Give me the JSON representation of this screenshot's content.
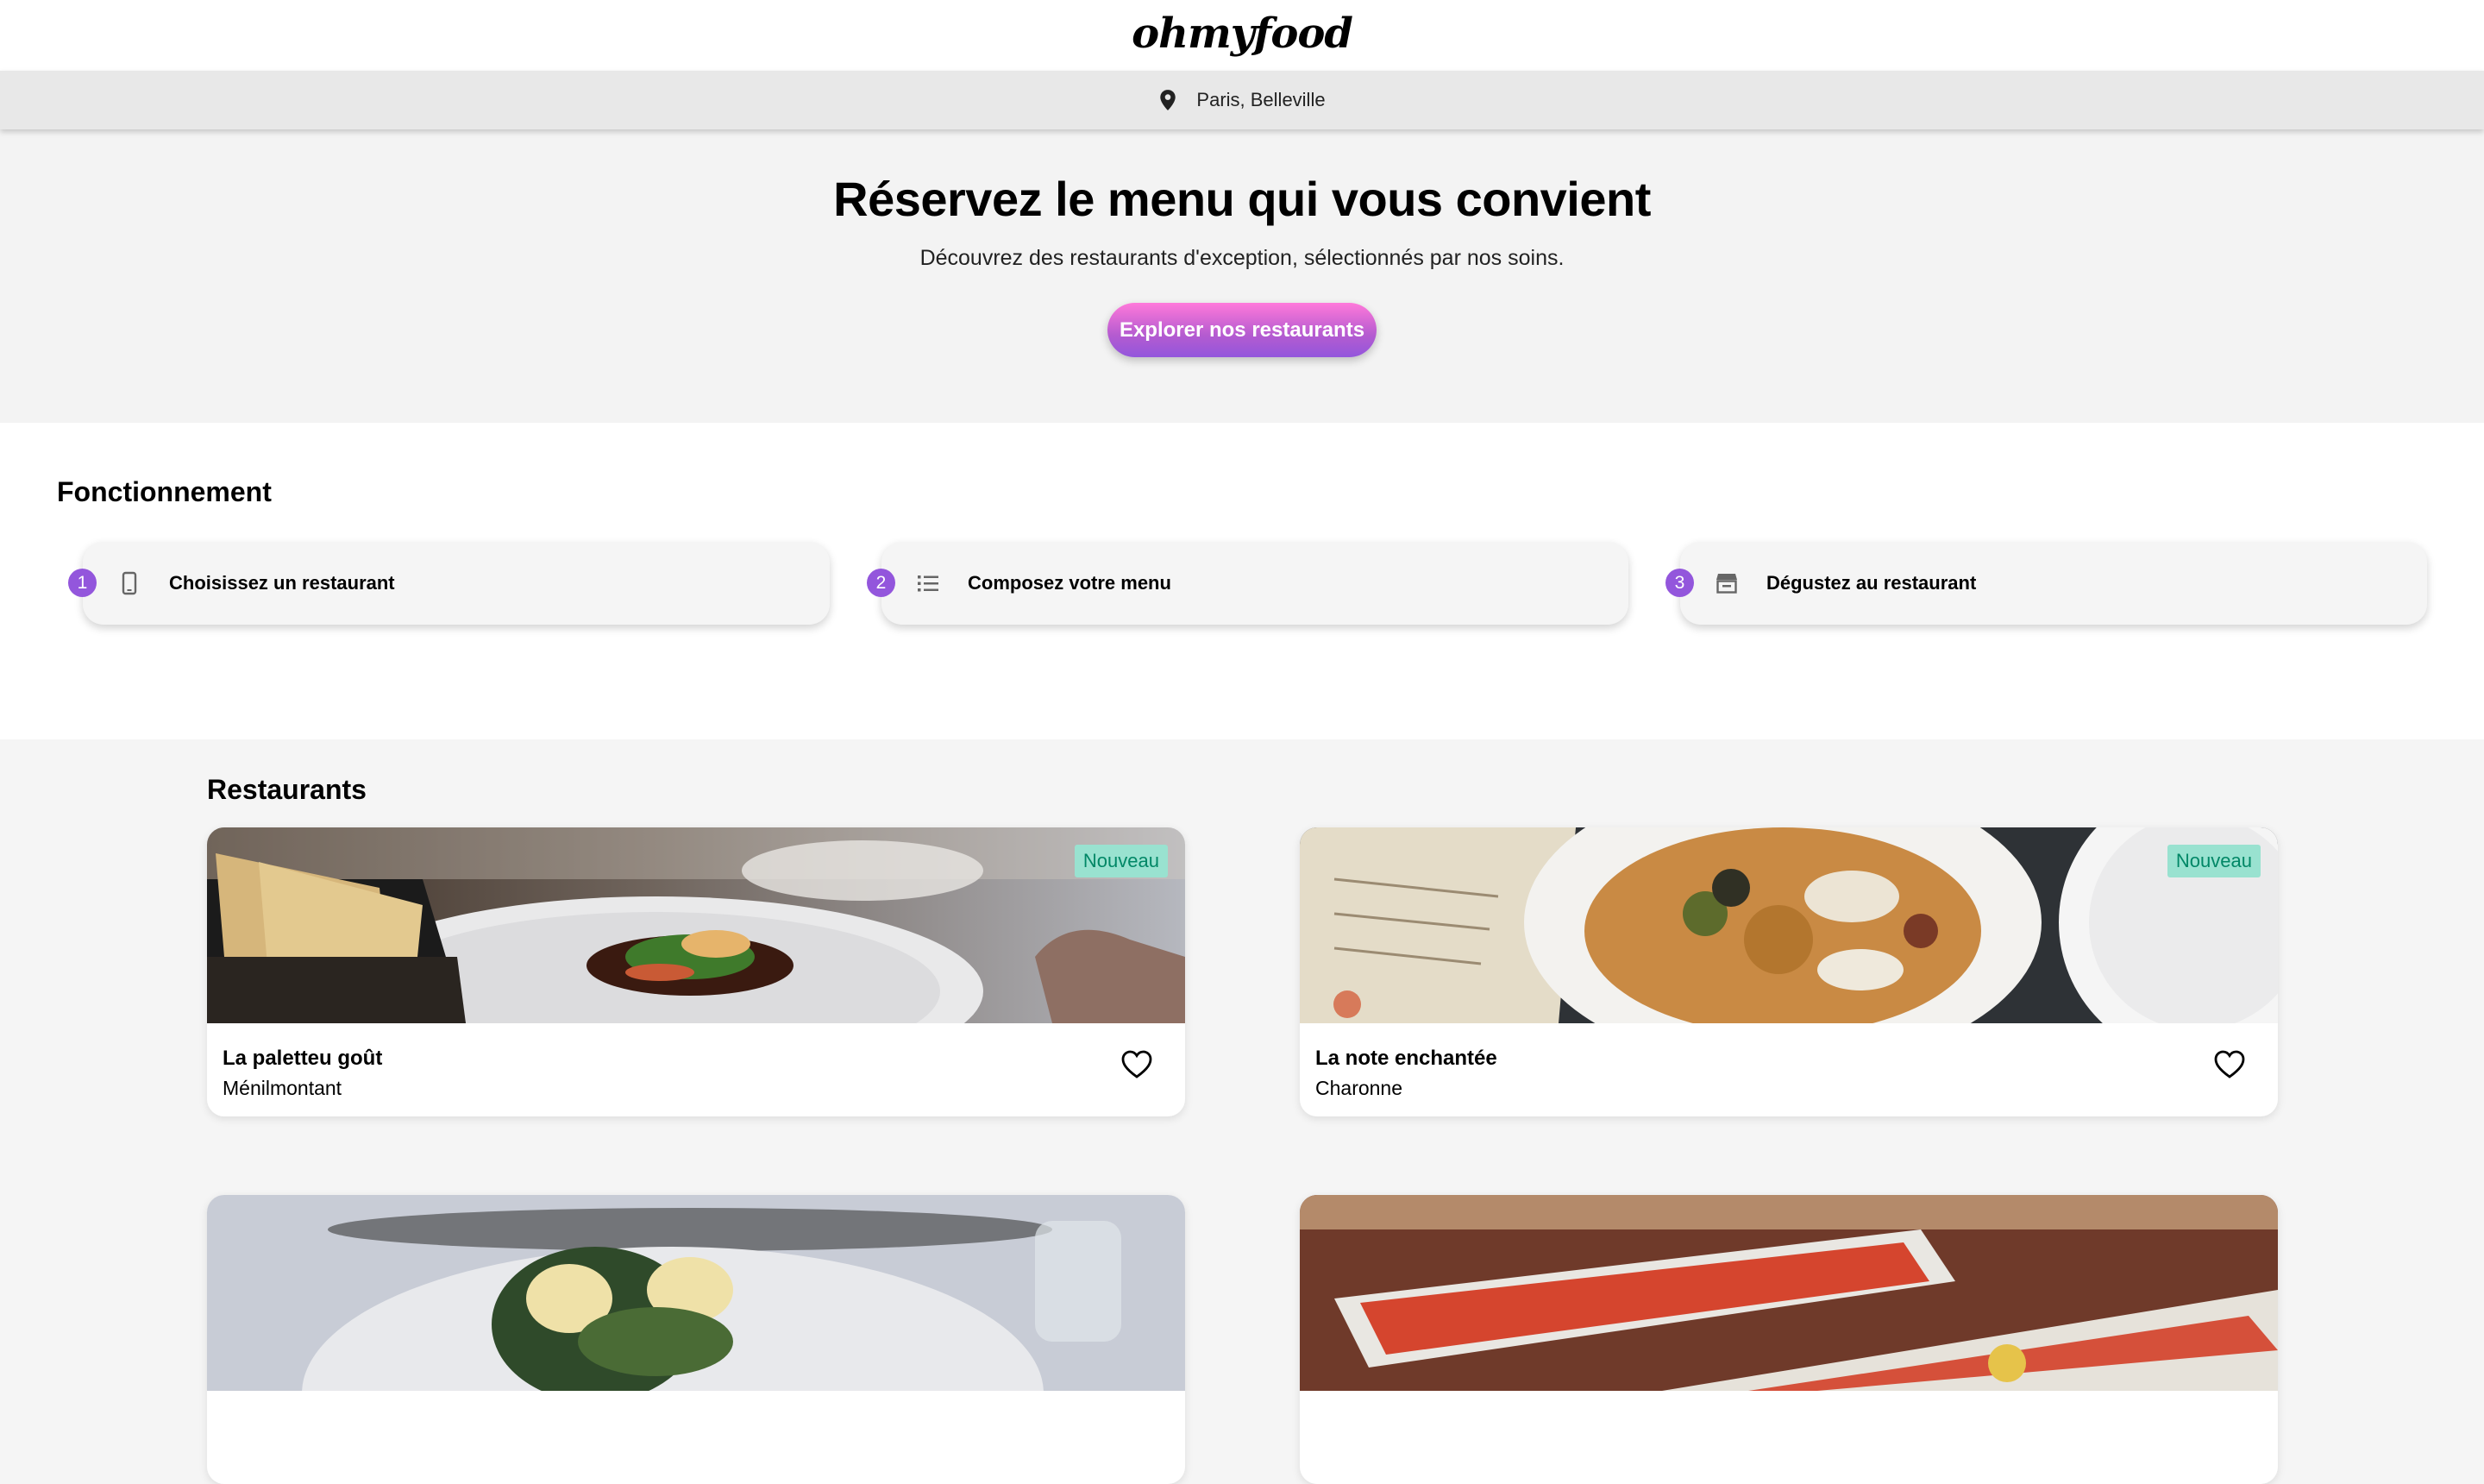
{
  "header": {
    "logo": "ohmyfood"
  },
  "location": {
    "text": "Paris, Belleville",
    "icon": "map-pin-icon"
  },
  "hero": {
    "title": "Réservez le menu qui vous convient",
    "subtitle": "Découvrez des restaurants d'exception, sélectionnés par nos soins.",
    "cta": "Explorer nos restaurants"
  },
  "how": {
    "title": "Fonctionnement",
    "steps": [
      {
        "num": "1",
        "label": "Choisissez un restaurant",
        "icon": "smartphone-icon"
      },
      {
        "num": "2",
        "label": "Composez votre menu",
        "icon": "list-icon"
      },
      {
        "num": "3",
        "label": "Dégustez au restaurant",
        "icon": "store-icon"
      }
    ]
  },
  "restaurants": {
    "title": "Restaurants",
    "items": [
      {
        "name": "La paletteu goût",
        "area": "Ménilmontant",
        "badge": "Nouveau"
      },
      {
        "name": "La note enchantée",
        "area": "Charonne",
        "badge": "Nouveau"
      },
      {
        "name": "",
        "area": "",
        "badge": ""
      },
      {
        "name": "",
        "area": "",
        "badge": ""
      }
    ]
  },
  "colors": {
    "accent_purple": "#9356dc",
    "accent_pink": "#ff79da",
    "badge_bg": "#99e2d0",
    "badge_text": "#008766"
  }
}
